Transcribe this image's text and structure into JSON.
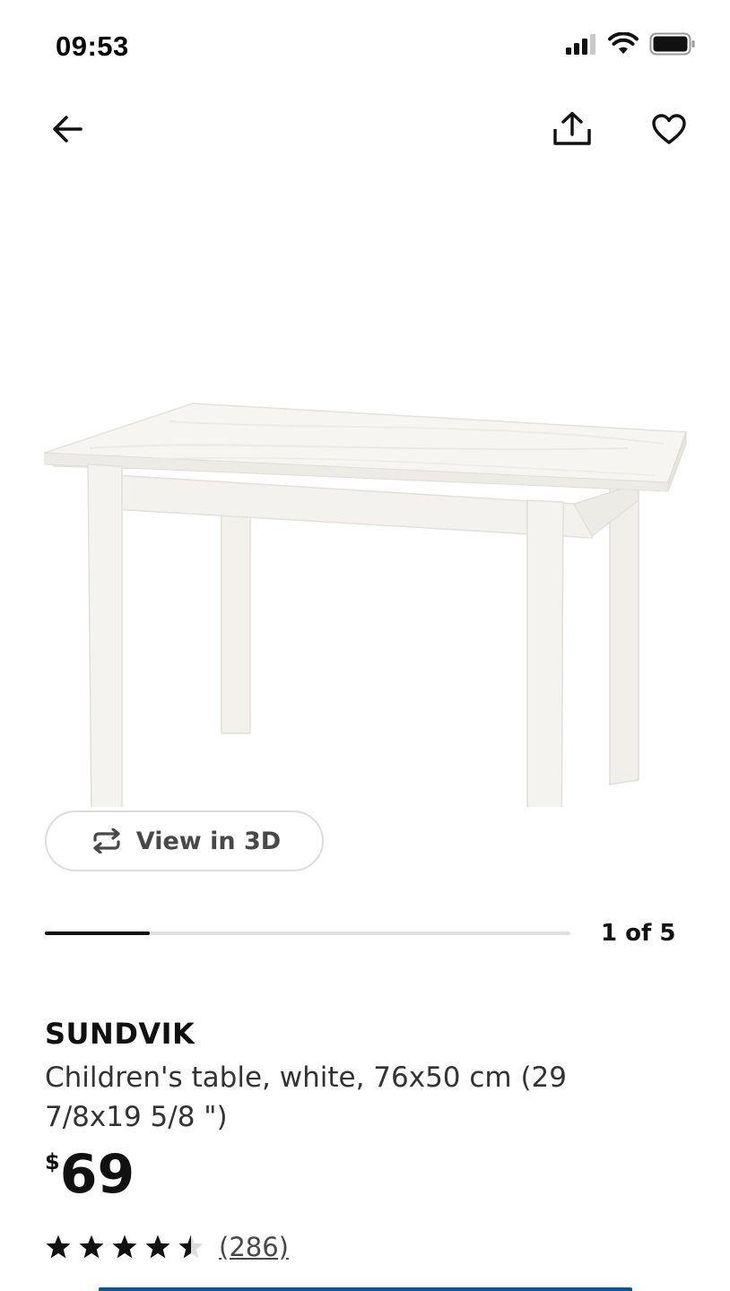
{
  "status_bar": {
    "time": "09:53"
  },
  "nav": {
    "back_icon": "arrow-left-icon",
    "share_icon": "share-icon",
    "favorite_icon": "heart-icon"
  },
  "gallery": {
    "view_3d_label": "View in 3D",
    "slide_counter": "1 of 5",
    "current_slide": 1,
    "total_slides": 5
  },
  "product": {
    "brand": "SUNDVIK",
    "description": "Children's table, white, 76x50 cm (29 7/8x19 5/8 \")",
    "price_currency": "$",
    "price_amount": "69",
    "rating": 4.5,
    "rating_max": 5,
    "review_count": "(286)"
  },
  "colors": {
    "text": "#111111",
    "muted": "#484848",
    "track": "#dfdfdf",
    "accent": "#0058a3"
  }
}
